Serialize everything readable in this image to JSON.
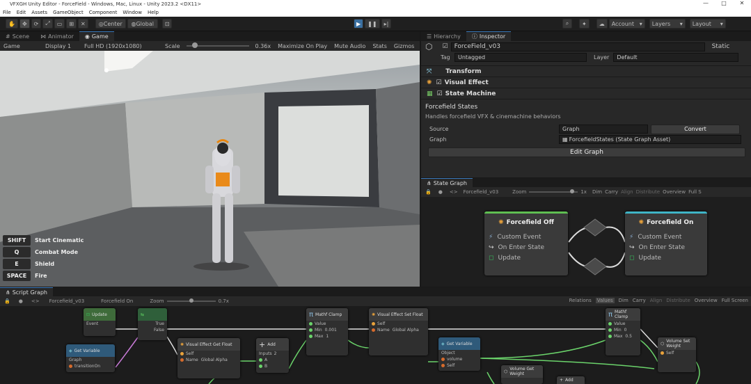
{
  "window": {
    "title": "VFXGH Unity Editor - ForceField - Windows, Mac, Linux - Unity 2023.2 <DX11>",
    "controls": [
      "—",
      "□",
      "✕"
    ]
  },
  "menu": [
    "File",
    "Edit",
    "Assets",
    "GameObject",
    "Component",
    "Window",
    "Help"
  ],
  "toolbar": {
    "center": "Center",
    "global": "Global",
    "account": "Account",
    "layers": "Layers",
    "layout": "Layout"
  },
  "scene_tabs": [
    "Scene",
    "Animator",
    "Game"
  ],
  "gamebar": {
    "mode": "Game",
    "display": "Display 1",
    "resolution": "Full HD (1920x1080)",
    "scale_label": "Scale",
    "scale_value": "0.36x",
    "scale_fraction": 0.1,
    "maximize": "Maximize On Play",
    "mute": "Mute Audio",
    "stats": "Stats",
    "gizmos": "Gizmos"
  },
  "hints": [
    {
      "key": "SHIFT",
      "label": "Start Cinematic"
    },
    {
      "key": "Q",
      "label": "Combat Mode"
    },
    {
      "key": "E",
      "label": "Shield"
    },
    {
      "key": "SPACE",
      "label": "Fire"
    }
  ],
  "inspector": {
    "tabs": [
      "Hierarchy",
      "Inspector"
    ],
    "object_name": "ForceField_v03",
    "static_label": "Static",
    "tag_label": "Tag",
    "tag_value": "Untagged",
    "layer_label": "Layer",
    "layer_value": "Default",
    "components": [
      "Transform",
      "Visual Effect",
      "State Machine"
    ],
    "section_title": "Forcefield States",
    "section_desc": "Handles forcefield VFX & cinemachine behaviors",
    "source_label": "Source",
    "source_value": "Graph",
    "convert_label": "Convert",
    "graph_label": "Graph",
    "graph_value": "ForcefieldStates (State Graph Asset)",
    "edit_graph": "Edit Graph"
  },
  "state_graph": {
    "tab": "State Graph",
    "asset": "Forcefield_v03",
    "zoom_label": "Zoom",
    "zoom_value": "1x",
    "zoom_fraction": 0.92,
    "toolbar": [
      "Dim",
      "Carry",
      "Align",
      "Distribute",
      "Overview",
      "Full S"
    ],
    "nodes": [
      {
        "title": "Forcefield Off",
        "lines": [
          "Custom Event",
          "On Enter State",
          "Update"
        ]
      },
      {
        "title": "Forcefield On",
        "lines": [
          "Custom Event",
          "On Enter State",
          "Update"
        ]
      }
    ]
  },
  "script_graph": {
    "tab": "Script Graph",
    "breadcrumb1": "Forcefield_v03",
    "breadcrumb2": "Forcefield On",
    "zoom_label": "Zoom",
    "zoom_value": "0.7x",
    "zoom_fraction": 0.5,
    "toolbar": [
      "Relations",
      "Values",
      "Dim",
      "Carry",
      "Align",
      "Distribute",
      "Overview",
      "Full Screen"
    ],
    "nodes": {
      "update": {
        "title": "Update",
        "sub": "Event"
      },
      "getvar": {
        "title": "Get Variable",
        "sub": "Graph",
        "val": "transitionOn"
      },
      "branch": {
        "true": "True",
        "false": "False"
      },
      "vfx_get": {
        "title": "Visual Effect",
        "sub": "Get Float",
        "self": "Self",
        "name": "Name",
        "name_val": "Global Alpha"
      },
      "add": {
        "title": "Add",
        "sub": "Inputs",
        "inputs": "2",
        "a": "A",
        "b": "B"
      },
      "clamp1": {
        "title": "Mathf",
        "sub": "Clamp",
        "value": "Value",
        "min": "Min",
        "min_val": "0.001",
        "max": "Max",
        "max_val": "1"
      },
      "vfx_set": {
        "title": "Visual Effect",
        "sub": "Set Float",
        "self": "Self",
        "name": "Name",
        "name_val": "Global Alpha"
      },
      "getvar2": {
        "title": "Get Variable",
        "sub": "Object",
        "val": "volume",
        "self": "Self"
      },
      "clamp2": {
        "title": "Mathf",
        "sub": "Clamp",
        "value": "Value",
        "min": "Min",
        "min_val": "0",
        "max": "Max",
        "max_val": "0.5"
      },
      "vol_set": {
        "title": "Volume",
        "sub": "Set Weight",
        "self": "Self"
      },
      "vol_get": {
        "title": "Volume",
        "sub": "Get Weight"
      },
      "add2": {
        "title": "Add"
      }
    }
  },
  "colors": {
    "accent": "#3a79bb",
    "flow": "#e0e0e0",
    "float": "#6bd46b",
    "object": "#d66b2c",
    "event_green": "#34c25a",
    "state_teal": "#3fb5c7"
  }
}
